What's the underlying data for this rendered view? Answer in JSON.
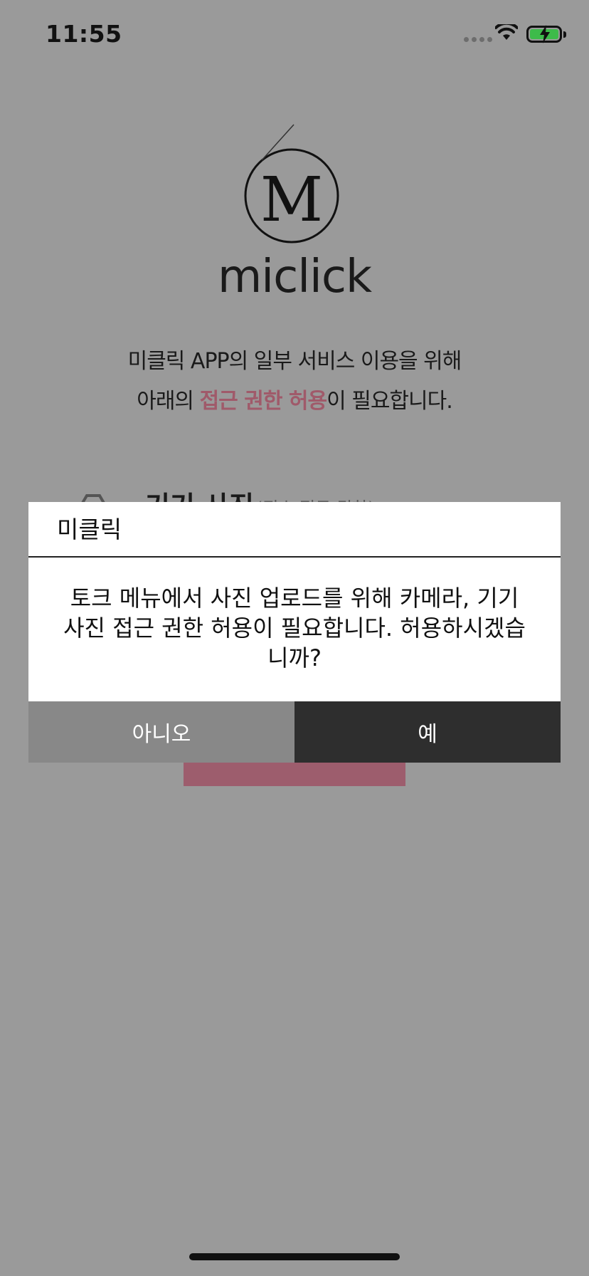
{
  "status_bar": {
    "time": "11:55"
  },
  "app": {
    "logo_letter": "M",
    "logo_word": "miclick",
    "intro_line1": "미클릭 APP의 일부 서비스 이용을 위해",
    "intro_line2_pre": "아래의 ",
    "intro_line2_accent": "접근 권한 허용",
    "intro_line2_post": "이 필요합니다.",
    "accent_color": "#a05a6a",
    "permission_title": "기기 사진",
    "permission_note": "(필수 접근 권한)"
  },
  "dialog": {
    "title": "미클릭",
    "message": "토크 메뉴에서 사진 업로드를 위해 카메라, 기기 사진 접근 권한 허용이 필요합니다. 허용하시겠습니까?",
    "no_label": "아니오",
    "yes_label": "예"
  }
}
